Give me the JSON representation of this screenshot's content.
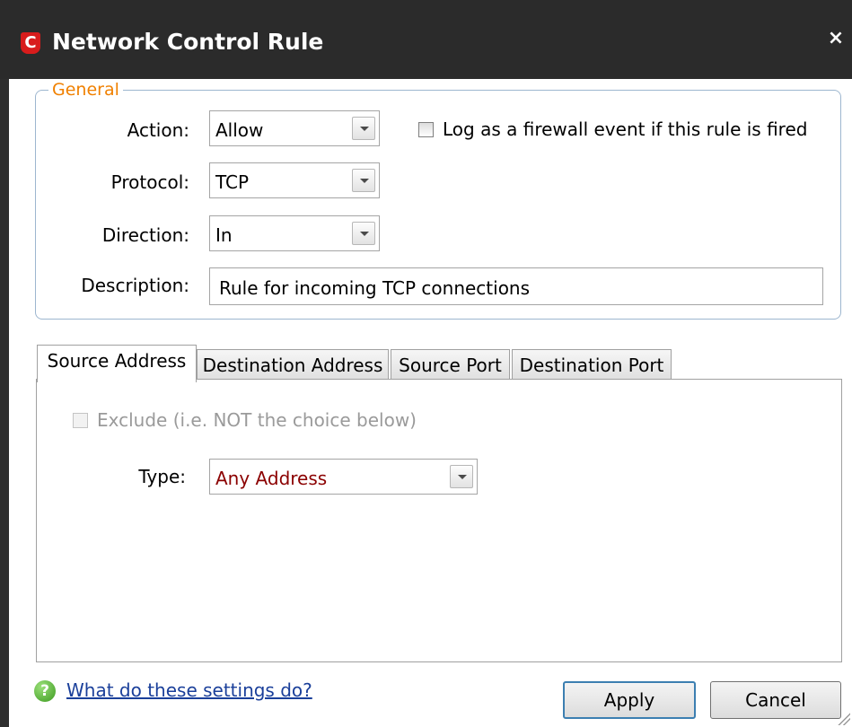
{
  "window": {
    "title": "Network Control Rule",
    "logo_letter": "C",
    "close_glyph": "×"
  },
  "general": {
    "legend": "General",
    "action": {
      "label": "Action:",
      "value": "Allow"
    },
    "protocol": {
      "label": "Protocol:",
      "value": "TCP"
    },
    "direction": {
      "label": "Direction:",
      "value": "In"
    },
    "description": {
      "label": "Description:",
      "value": "Rule for incoming TCP connections"
    },
    "log_checkbox": {
      "label": "Log as a firewall event if this rule is fired",
      "checked": false
    }
  },
  "tabs": [
    {
      "label": "Source Address",
      "active": true
    },
    {
      "label": "Destination Address",
      "active": false
    },
    {
      "label": "Source Port",
      "active": false
    },
    {
      "label": "Destination Port",
      "active": false
    }
  ],
  "panel": {
    "exclude": {
      "label": "Exclude (i.e. NOT the choice below)",
      "checked": false,
      "enabled": false
    },
    "type": {
      "label": "Type:",
      "value": "Any Address"
    }
  },
  "footer": {
    "help_link": "What do these settings do?",
    "help_icon_glyph": "?",
    "apply_label": "Apply",
    "cancel_label": "Cancel"
  },
  "colors": {
    "titlebar": "#2b2b2b",
    "legend": "#f08000",
    "group_border": "#9db6cf",
    "type_value": "#8b0000",
    "link": "#1a3f9a"
  }
}
